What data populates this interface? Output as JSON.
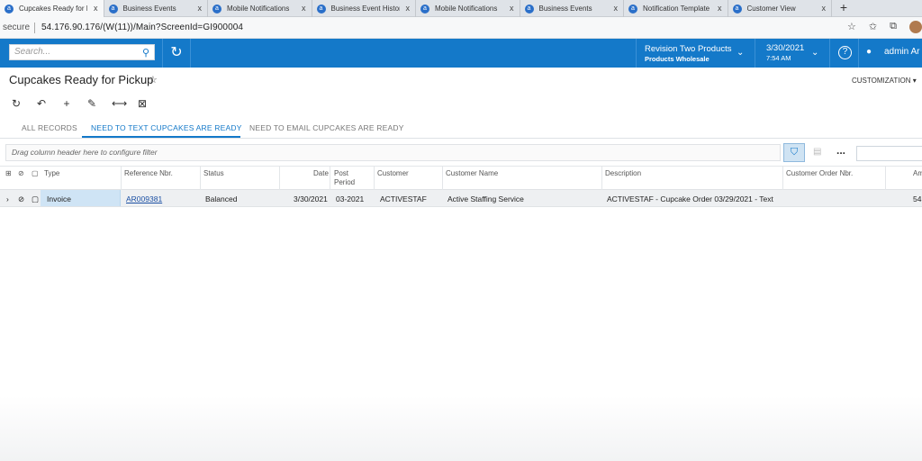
{
  "browser": {
    "tabs": [
      {
        "label": "Cupcakes Ready for Pi",
        "active": true
      },
      {
        "label": "Business Events",
        "active": false
      },
      {
        "label": "Mobile Notifications",
        "active": false
      },
      {
        "label": "Business Event Histor",
        "active": false
      },
      {
        "label": "Mobile Notifications",
        "active": false
      },
      {
        "label": "Business Events",
        "active": false
      },
      {
        "label": "Notification Template",
        "active": false
      },
      {
        "label": "Customer View",
        "active": false
      }
    ],
    "close_glyph": "x",
    "new_tab_glyph": "+",
    "secure_text": "secure",
    "url": "54.176.90.176/(W(11))/Main?ScreenId=GI900004"
  },
  "topbar": {
    "search_placeholder": "Search...",
    "branch_title": "Revision Two Products",
    "branch_subtitle": "Products Wholesale",
    "date": "3/30/2021",
    "time": "7:54 AM",
    "help_glyph": "?",
    "user": "admin Ar",
    "accent_color": "#1479c9"
  },
  "page": {
    "title": "Cupcakes Ready for Pickup",
    "customization": "CUSTOMIZATION",
    "toolbar_icons": [
      "refresh-icon",
      "undo-icon",
      "add-icon",
      "edit-icon",
      "fit-columns-icon",
      "export-excel-icon"
    ],
    "subtabs": [
      "ALL RECORDS",
      "NEED TO TEXT CUPCAKES ARE READY",
      "NEED TO EMAIL CUPCAKES ARE READY"
    ],
    "active_subtab": 1,
    "filter_hint": "Drag column header here to configure filter",
    "more_glyph": "..."
  },
  "grid": {
    "columns": [
      "Type",
      "Reference Nbr.",
      "Status",
      "Date",
      "Post",
      "Period",
      "Customer",
      "Customer Name",
      "Description",
      "Customer Order Nbr.",
      "Am"
    ],
    "rows": [
      {
        "type": "Invoice",
        "reference": "AR009381",
        "status": "Balanced",
        "date": "3/30/2021",
        "post_period": "03-2021",
        "customer": "ACTIVESTAF",
        "customer_name": "Active Staffing Service",
        "description": "ACTIVESTAF - Cupcake Order 03/29/2021 - Text",
        "customer_order": "",
        "amount": "54"
      }
    ]
  }
}
